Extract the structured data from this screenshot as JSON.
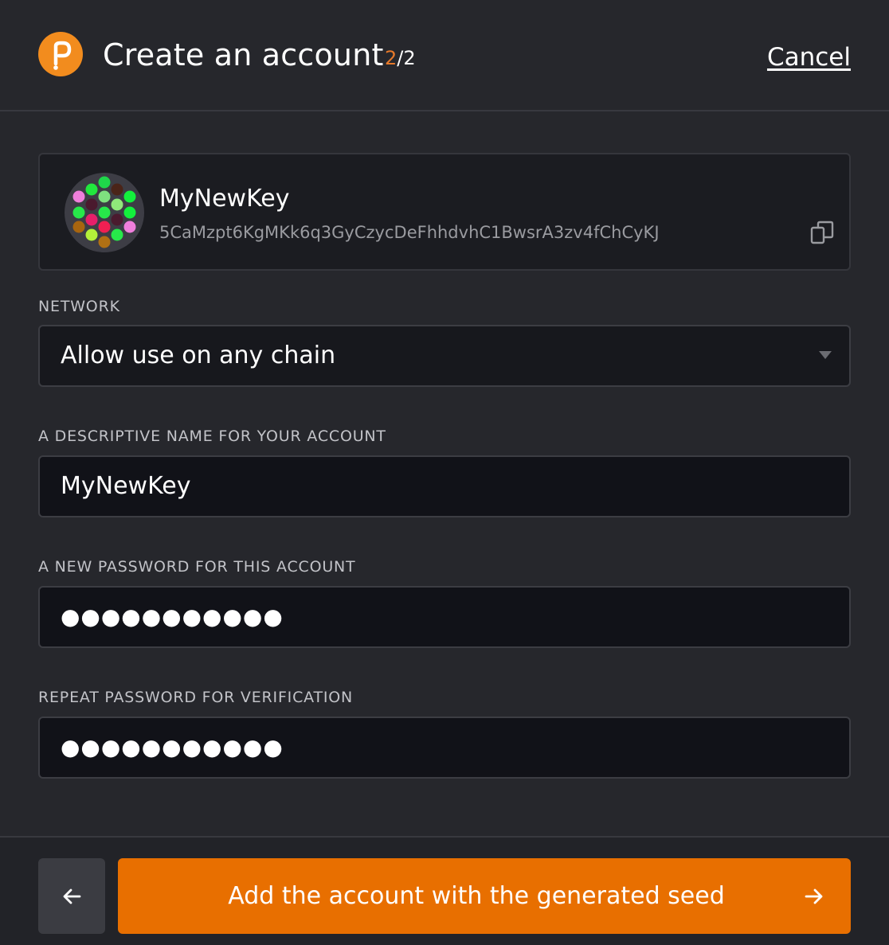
{
  "header": {
    "title": "Create an account",
    "step_current": "2",
    "step_total": "/2",
    "cancel_label": "Cancel",
    "logo_icon": "polkadot-logo-icon"
  },
  "account": {
    "name": "MyNewKey",
    "address": "5CaMzpt6KgMKk6q3GyCzycDeFhhdvhC1BwsrA3zv4fChCyKJ",
    "avatar_icon": "identicon-avatar",
    "copy_icon": "copy-icon"
  },
  "network": {
    "label": "NETWORK",
    "selected": "Allow use on any chain"
  },
  "name_field": {
    "label": "A DESCRIPTIVE NAME FOR YOUR ACCOUNT",
    "value": "MyNewKey"
  },
  "password_field": {
    "label": "A NEW PASSWORD FOR THIS ACCOUNT",
    "value": "●●●●●●●●●●●"
  },
  "repeat_password_field": {
    "label": "REPEAT PASSWORD FOR VERIFICATION",
    "value": "●●●●●●●●●●●"
  },
  "footer": {
    "back_icon": "arrow-left-icon",
    "submit_label": "Add the account with the generated seed",
    "submit_icon": "arrow-right-icon"
  },
  "colors": {
    "accent": "#e86f00",
    "step_highlight": "#e6792a",
    "background": "#26272c",
    "input_background": "#111218"
  }
}
